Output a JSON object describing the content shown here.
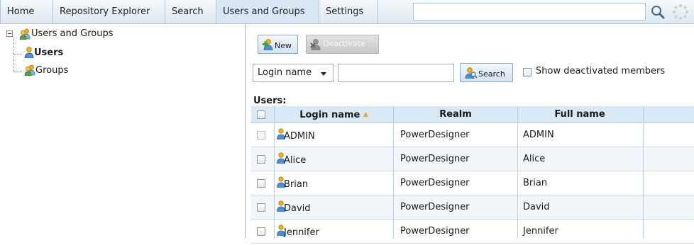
{
  "nav": {
    "tabs": [
      {
        "label": "Home"
      },
      {
        "label": "Repository Explorer"
      },
      {
        "label": "Search"
      },
      {
        "label": "Users and Groups",
        "active": true
      },
      {
        "label": "Settings"
      }
    ],
    "search_value": ""
  },
  "tree": {
    "root_label": "Users and Groups",
    "items": [
      {
        "label": "Users",
        "selected": true
      },
      {
        "label": "Groups"
      }
    ]
  },
  "toolbar": {
    "new_label": "New",
    "deactivate_label": "Deactivate"
  },
  "filter": {
    "field_selected": "Login name",
    "value": "",
    "search_label": "Search",
    "show_deactivated_label": "Show deactivated members",
    "show_deactivated_checked": false
  },
  "users_table": {
    "caption": "Users:",
    "columns": [
      "Login name",
      "Realm",
      "Full name"
    ],
    "sorted_column": "Login name",
    "rows": [
      {
        "login": "ADMIN",
        "realm": "PowerDesigner",
        "full_name": "ADMIN"
      },
      {
        "login": "Alice",
        "realm": "PowerDesigner",
        "full_name": "Alice"
      },
      {
        "login": "Brian",
        "realm": "PowerDesigner",
        "full_name": "Brian"
      },
      {
        "login": "David",
        "realm": "PowerDesigner",
        "full_name": "David"
      },
      {
        "login": "Jennifer",
        "realm": "PowerDesigner",
        "full_name": "Jennifer"
      }
    ]
  },
  "colors": {
    "accent": "#d8e7f3",
    "header_bg": "#d8e9f5",
    "sort_arrow": "#f0a030",
    "user_icon": "#f2b01e"
  },
  "icons": {
    "user": "user-icon",
    "group": "group-icon",
    "new_user": "new-user-icon",
    "deactivate_user": "deactivate-user-icon",
    "search": "search-icon",
    "magnifier": "magnifier-icon",
    "loading": "loading-spinner-icon"
  }
}
